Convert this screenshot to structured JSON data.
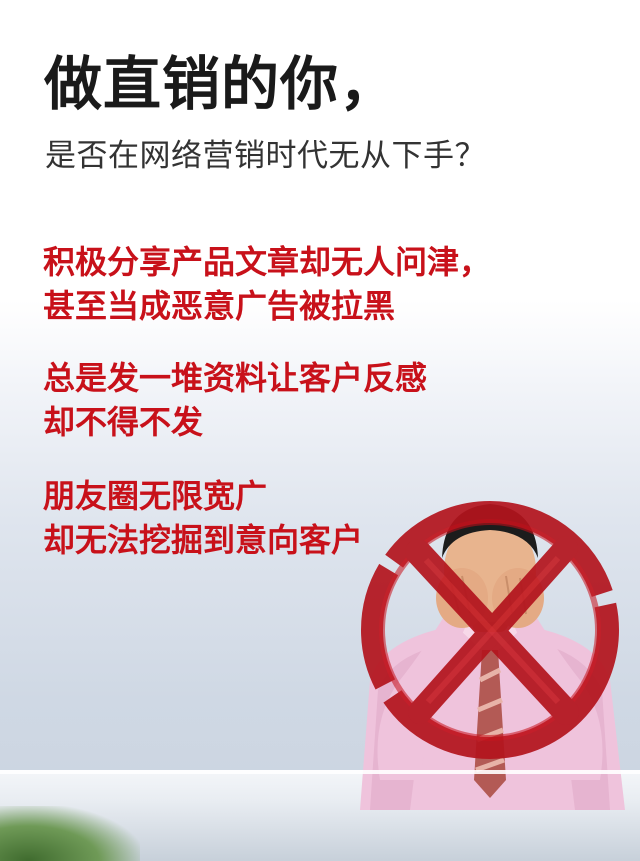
{
  "headline": "做直销的你，",
  "subheadline": "是否在网络营销时代无从下手？",
  "pain_points": [
    {
      "line1": "积极分享产品文章却无人问津，",
      "line2": "甚至当成恶意广告被拉黑"
    },
    {
      "line1": "总是发一堆资料让客户反感",
      "line2": "却不得不发"
    },
    {
      "line1": "朋友圈无限宽广",
      "line2": "却无法挖掘到意向客户"
    }
  ],
  "colors": {
    "headline": "#1a1a1a",
    "subheadline": "#333333",
    "accent_red": "#c8111a",
    "shirt": "#efc3dc",
    "hair": "#1c1c1c",
    "skin": "#e8b48e"
  },
  "illustration": {
    "subject": "frustrated-businessman",
    "mark": "red-brush-x-icon"
  }
}
